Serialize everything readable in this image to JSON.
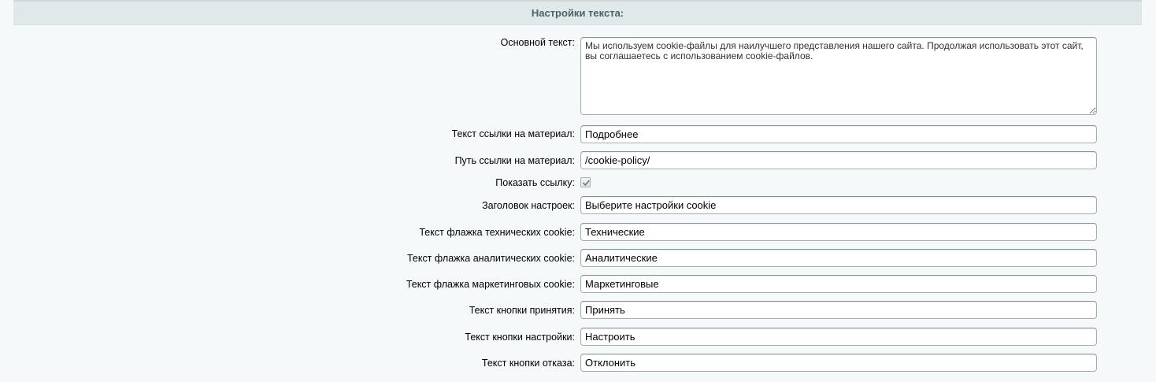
{
  "section": {
    "title": "Настройки текста:"
  },
  "form": {
    "main_text": {
      "label": "Основной текст:",
      "value": "Мы используем cookie-файлы для наилучшего представления нашего сайта. Продолжая использовать этот сайт, вы соглашаетесь с использованием cookie-файлов."
    },
    "link_text": {
      "label": "Текст ссылки на материал:",
      "value": "Подробнее"
    },
    "link_path": {
      "label": "Путь ссылки на материал:",
      "value": "/cookie-policy/"
    },
    "show_link": {
      "label": "Показать ссылку:",
      "checked": true
    },
    "settings_title": {
      "label": "Заголовок настроек:",
      "value": "Выберите настройки cookie"
    },
    "technical_flag": {
      "label": "Текст флажка технических cookie:",
      "value": "Технические"
    },
    "analytics_flag": {
      "label": "Текст флажка аналитических cookie:",
      "value": "Аналитические"
    },
    "marketing_flag": {
      "label": "Текст флажка маркетинговых cookie:",
      "value": "Маркетинговые"
    },
    "accept_button": {
      "label": "Текст кнопки принятия:",
      "value": "Принять"
    },
    "settings_button": {
      "label": "Текст кнопки настройки:",
      "value": "Настроить"
    },
    "decline_button": {
      "label": "Текст кнопки отказа:",
      "value": "Отклонить"
    }
  },
  "icons": {
    "checkmark": "check-icon"
  },
  "colors": {
    "background": "#f5f9f9",
    "header_bg": "#e0e8ea",
    "header_text": "#4b6267",
    "field_border": "#a3acb1"
  }
}
